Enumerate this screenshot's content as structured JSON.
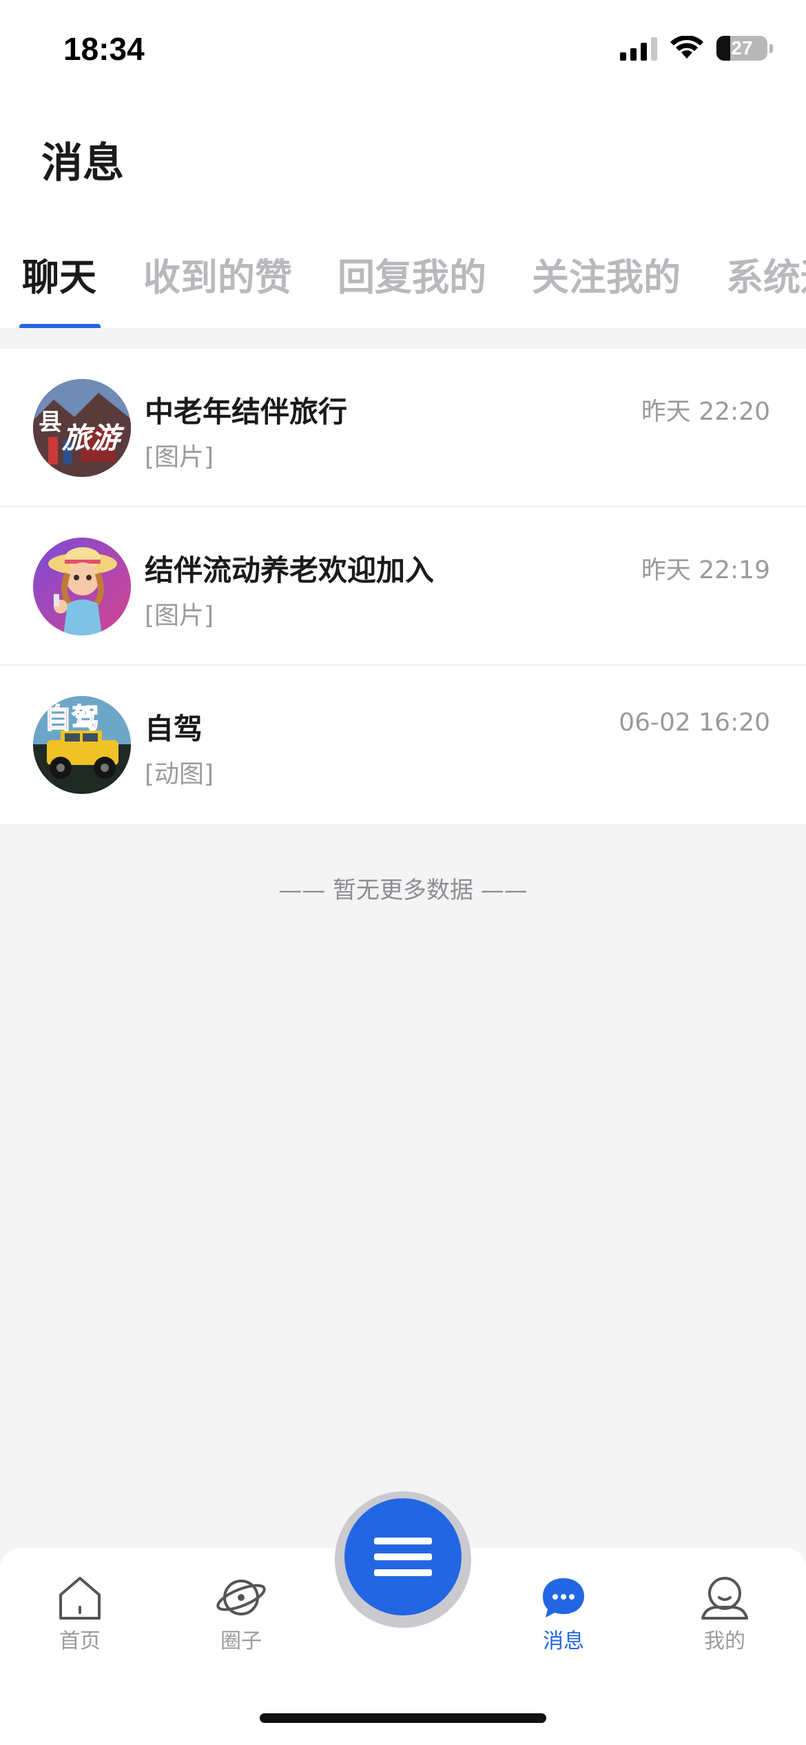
{
  "status_bar": {
    "time": "18:34",
    "battery_level": "27"
  },
  "header": {
    "title": "消息"
  },
  "tabs": [
    {
      "label": "聊天",
      "active": true
    },
    {
      "label": "收到的赞",
      "active": false
    },
    {
      "label": "回复我的",
      "active": false
    },
    {
      "label": "关注我的",
      "active": false
    },
    {
      "label": "系统通知",
      "active": false
    }
  ],
  "chats": [
    {
      "name": "中老年结伴旅行",
      "preview": "[图片]",
      "time": "昨天 22:20",
      "avatar_icon": "travel-group-avatar",
      "avatar_text": [
        "县",
        "旅游"
      ]
    },
    {
      "name": "结伴流动养老欢迎加入",
      "preview": "[图片]",
      "time": "昨天 22:19",
      "avatar_icon": "cartoon-girl-avatar"
    },
    {
      "name": "自驾",
      "preview": "[动图]",
      "time": "06-02 16:20",
      "avatar_icon": "jeep-avatar",
      "avatar_text": [
        "自驾"
      ]
    }
  ],
  "list_footer": "—— 暂无更多数据 ——",
  "bottom_nav": [
    {
      "label": "首页",
      "icon": "house-icon",
      "active": false
    },
    {
      "label": "圈子",
      "icon": "planet-icon",
      "active": false
    },
    {
      "label": "",
      "icon": "menu-icon",
      "active": false
    },
    {
      "label": "消息",
      "icon": "chat-bubble-icon",
      "active": true
    },
    {
      "label": "我的",
      "icon": "person-icon",
      "active": false
    }
  ],
  "colors": {
    "accent": "#2266e3",
    "inactive": "#9a9a9e",
    "background": "#f4f4f5"
  }
}
